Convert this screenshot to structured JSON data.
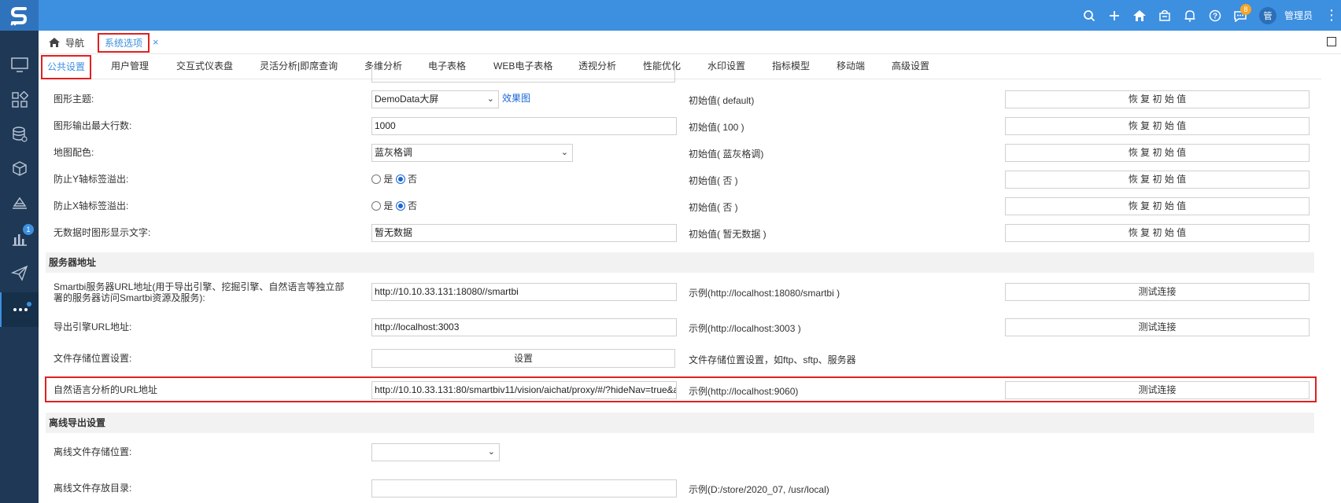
{
  "topbar": {
    "logo": "S",
    "notification_badge": "8",
    "avatar_text": "管",
    "username": "管理员",
    "more": "⋮"
  },
  "sidebar": {
    "badge": "1"
  },
  "tabs": {
    "nav_label": "导航",
    "system_label": "系统选项",
    "close": "×"
  },
  "subtabs": [
    "公共设置",
    "用户管理",
    "交互式仪表盘",
    "灵活分析|即席查询",
    "多维分析",
    "电子表格",
    "WEB电子表格",
    "透视分析",
    "性能优化",
    "水印设置",
    "指标模型",
    "移动端",
    "高级设置"
  ],
  "rows": [
    {
      "label": "图形主题:",
      "value": "DemoData大屏",
      "link": "效果图",
      "init": "初始值( default)",
      "button": "恢 复 初 始 值"
    },
    {
      "label": "图形输出最大行数:",
      "value": "1000",
      "init": "初始值( 100 )",
      "button": "恢 复 初 始 值"
    },
    {
      "label": "地图配色:",
      "value": "蓝灰格调",
      "init": "初始值( 蓝灰格调)",
      "button": "恢 复 初 始 值"
    },
    {
      "label": "防止Y轴标签溢出:",
      "opt_yes": "是",
      "opt_no": "否",
      "init": "初始值( 否 )",
      "button": "恢 复 初 始 值"
    },
    {
      "label": "防止X轴标签溢出:",
      "opt_yes": "是",
      "opt_no": "否",
      "init": "初始值( 否 )",
      "button": "恢 复 初 始 值"
    },
    {
      "label": "无数据时图形显示文字:",
      "value": "暂无数据",
      "init": "初始值( 暂无数据 )",
      "button": "恢 复 初 始 值"
    }
  ],
  "server_section": {
    "title": "服务器地址",
    "rows": [
      {
        "label_line1": "Smartbi服务器URL地址(用于导出引擎、挖掘引擎、自然语言等独立部",
        "label_line2": "署的服务器访问Smartbi资源及服务):",
        "value": "http://10.10.33.131:18080//smartbi",
        "init": "示例(http://localhost:18080/smartbi )",
        "button": "测试连接"
      },
      {
        "label": "导出引擎URL地址:",
        "value": "http://localhost:3003",
        "init": "示例(http://localhost:3003 )",
        "button": "测试连接"
      },
      {
        "label": "文件存储位置设置:",
        "button_mid": "设置",
        "init": "文件存储位置设置，如ftp、sftp、服务器"
      },
      {
        "label": "自然语言分析的URL地址",
        "value": "http://10.10.33.131:80/smartbiv11/vision/aichat/proxy/#/?hideNav=true&a",
        "init": "示例(http://localhost:9060)",
        "button": "测试连接"
      }
    ]
  },
  "offline_section": {
    "title": "离线导出设置",
    "rows": [
      {
        "label": "离线文件存储位置:",
        "value": ""
      },
      {
        "label": "离线文件存放目录:",
        "value": "",
        "init": "示例(D:/store/2020_07, /usr/local)"
      }
    ]
  }
}
